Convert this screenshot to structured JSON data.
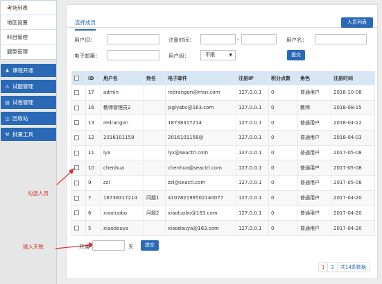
{
  "sidebar": {
    "top_items": [
      {
        "label": "考场列表"
      },
      {
        "label": "地区设置"
      },
      {
        "label": "科目管理"
      },
      {
        "label": "题型管理"
      }
    ],
    "nav_buttons": [
      {
        "label": "课程开通",
        "icon": "person-icon"
      },
      {
        "label": "试题管理",
        "icon": "warning-icon"
      },
      {
        "label": "试卷管理",
        "icon": "document-icon"
      },
      {
        "label": "回收站",
        "icon": "trash-icon"
      },
      {
        "label": "批量工具",
        "icon": "wrench-icon"
      }
    ]
  },
  "tabs": {
    "active": "选择成员"
  },
  "header": {
    "member_list_button": "人员列表"
  },
  "filters": {
    "user_id_label": "用户ID：",
    "reg_time_label": "注册时间：",
    "username_label": "用户名：",
    "email_label": "电子邮箱：",
    "user_group_label": "用户组：",
    "user_group_value": "不限",
    "date_separator": "-",
    "submit": "提交"
  },
  "table": {
    "headers": [
      "ID",
      "用户名",
      "姓名",
      "电子邮件",
      "注册IP",
      "积分点数",
      "角色",
      "注册时间"
    ],
    "rows": [
      {
        "id": "17",
        "username": "admin",
        "name": "",
        "email": "redrangon@msn.com",
        "ip": "127.0.0.1",
        "points": "0",
        "role": "普通用户",
        "date": "2018-10-08"
      },
      {
        "id": "16",
        "username": "教师管理员2",
        "name": "",
        "email": "jsglyabc@163.com",
        "ip": "127.0.0.1",
        "points": "0",
        "role": "教师",
        "date": "2018-08-15"
      },
      {
        "id": "13",
        "username": "redrangon",
        "name": "",
        "email": "18738317214",
        "ip": "127.0.0.1",
        "points": "0",
        "role": "普通用户",
        "date": "2018-04-12"
      },
      {
        "id": "12",
        "username": "2016101158",
        "name": "",
        "email": "2016101158@",
        "ip": "127.0.0.1",
        "points": "0",
        "role": "普通用户",
        "date": "2018-04-03"
      },
      {
        "id": "11",
        "username": "lyx",
        "name": "",
        "email": "lyx@seactrl.com",
        "ip": "127.0.0.1",
        "points": "0",
        "role": "普通用户",
        "date": "2017-05-08"
      },
      {
        "id": "10",
        "username": "chenhua",
        "name": "",
        "email": "chenhua@seactrl.com",
        "ip": "127.0.0.1",
        "points": "0",
        "role": "普通用户",
        "date": "2017-05-08"
      },
      {
        "id": "9",
        "username": "zzl",
        "name": "",
        "email": "zzl@seactl.com",
        "ip": "127.0.0.1",
        "points": "0",
        "role": "普通用户",
        "date": "2017-05-08"
      },
      {
        "id": "7",
        "username": "18738317214",
        "name": "问题1",
        "email": "410782198502140077",
        "ip": "127.0.0.1",
        "points": "0",
        "role": "普通用户",
        "date": "2017-04-20"
      },
      {
        "id": "6",
        "username": "xiaoluobo",
        "name": "问题2",
        "email": "xiaoluobo@163.com",
        "ip": "127.0.0.1",
        "points": "0",
        "role": "普通用户",
        "date": "2017-04-20"
      },
      {
        "id": "5",
        "username": "xiaodouya",
        "name": "",
        "email": "xiaodouya@163.com",
        "ip": "127.0.0.1",
        "points": "0",
        "role": "普通用户",
        "date": "2017-04-20"
      }
    ]
  },
  "activation": {
    "open_label": "开通",
    "days_unit": "天",
    "submit": "提交"
  },
  "annotations": {
    "select_members": "勾选人员",
    "enter_days": "输入天数"
  },
  "pagination": {
    "pages": [
      "1",
      "2"
    ],
    "total": "共14条数据",
    "active": "1"
  },
  "colors": {
    "primary": "#2a69b5",
    "table_header": "#d6e6f5",
    "annotation": "#d9342b"
  }
}
